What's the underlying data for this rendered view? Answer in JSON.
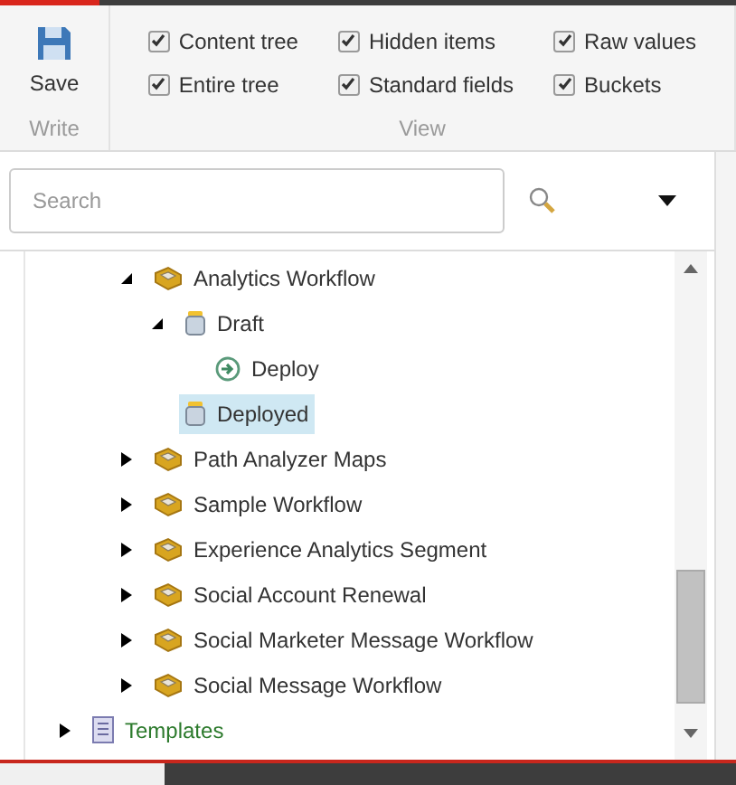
{
  "ribbon": {
    "groups": [
      {
        "label": "Write",
        "buttons": [
          {
            "label": "Save"
          }
        ]
      },
      {
        "label": "View",
        "checkboxes": [
          {
            "label": "Content tree",
            "checked": true
          },
          {
            "label": "Entire tree",
            "checked": true
          },
          {
            "label": "Hidden items",
            "checked": true
          },
          {
            "label": "Standard fields",
            "checked": true
          },
          {
            "label": "Raw values",
            "checked": true
          },
          {
            "label": "Buckets",
            "checked": true
          }
        ]
      }
    ]
  },
  "search": {
    "placeholder": "Search"
  },
  "tree": [
    {
      "children": [
        {
          "children": [
            {
              "label": "Analytics Workflow",
              "kind": "workflow",
              "expanded": true,
              "selected": false,
              "children": [
                {
                  "label": "Draft",
                  "kind": "state",
                  "expanded": true,
                  "selected": false,
                  "children": [
                    {
                      "label": "Deploy",
                      "kind": "command",
                      "selected": false
                    }
                  ]
                },
                {
                  "label": "Deployed",
                  "kind": "state",
                  "selected": true
                }
              ]
            },
            {
              "label": "Path Analyzer Maps",
              "kind": "workflow",
              "expanded": false,
              "selected": false
            },
            {
              "label": "Sample Workflow",
              "kind": "workflow",
              "expanded": false,
              "selected": false
            },
            {
              "label": "Experience Analytics Segment",
              "kind": "workflow",
              "expanded": false,
              "selected": false
            },
            {
              "label": "Social Account Renewal",
              "kind": "workflow",
              "expanded": false,
              "selected": false
            },
            {
              "label": "Social Marketer Message Workflow",
              "kind": "workflow",
              "expanded": false,
              "selected": false
            },
            {
              "label": "Social Message Workflow",
              "kind": "workflow",
              "expanded": false,
              "selected": false
            }
          ]
        }
      ]
    },
    {
      "label": "Templates",
      "kind": "template",
      "expanded": false,
      "selected": false
    }
  ]
}
